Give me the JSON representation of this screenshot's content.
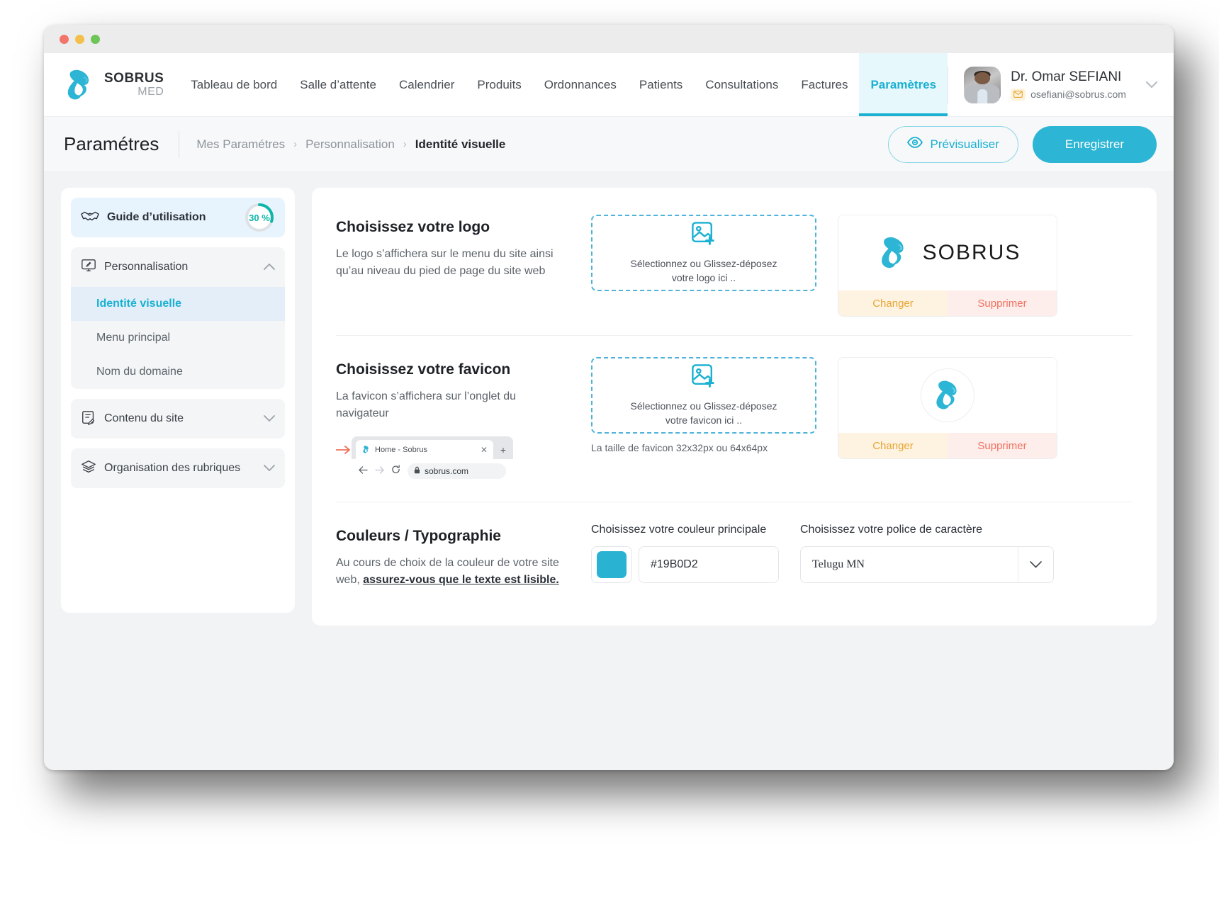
{
  "window": {
    "traffic_lights": [
      "close",
      "minimize",
      "maximize"
    ]
  },
  "navbar": {
    "brand": {
      "name": "SOBRUS",
      "sub": "MED",
      "logo_icon": "sobrus-swan-logo"
    },
    "links": [
      {
        "label": "Tableau de bord",
        "active": false
      },
      {
        "label": "Salle d’attente",
        "active": false
      },
      {
        "label": "Calendrier",
        "active": false
      },
      {
        "label": "Produits",
        "active": false
      },
      {
        "label": "Ordonnances",
        "active": false
      },
      {
        "label": "Patients",
        "active": false
      },
      {
        "label": "Consultations",
        "active": false
      },
      {
        "label": "Factures",
        "active": false
      },
      {
        "label": "Paramètres",
        "active": true
      }
    ],
    "user": {
      "name": "Dr. Omar SEFIANI",
      "email": "osefiani@sobrus.com",
      "mail_icon": "envelope-icon",
      "caret_icon": "chevron-down-icon"
    }
  },
  "page_header": {
    "title": "Paramétres",
    "breadcrumb": [
      {
        "label": "Mes Paramétres",
        "current": false
      },
      {
        "label": "Personnalisation",
        "current": false
      },
      {
        "label": "Identité visuelle",
        "current": true
      }
    ],
    "separator": "›",
    "preview_button": {
      "label": "Prévisualiser",
      "icon": "eye-icon"
    },
    "save_button": {
      "label": "Enregistrer"
    }
  },
  "sidebar": {
    "guide": {
      "label": "Guide d’utilisation",
      "icon": "handshake-icon",
      "percent_label": "30 %",
      "percent_value": 30,
      "ring_color": "#0fb6a8"
    },
    "groups": [
      {
        "label": "Personnalisation",
        "icon": "monitor-brush-icon",
        "caret": "chevron-up-icon",
        "expanded": true,
        "items": [
          {
            "label": "Identité visuelle",
            "active": true
          },
          {
            "label": "Menu principal",
            "active": false
          },
          {
            "label": "Nom du domaine",
            "active": false
          }
        ]
      },
      {
        "label": "Contenu du site",
        "icon": "document-edit-icon",
        "caret": "chevron-down-icon",
        "expanded": false,
        "items": []
      },
      {
        "label": "Organisation des rubriques",
        "icon": "layers-icon",
        "caret": "chevron-down-icon",
        "expanded": false,
        "items": []
      }
    ]
  },
  "main": {
    "logo_section": {
      "title": "Choisissez votre logo",
      "description": "Le logo s’affichera sur le menu du site ainsi qu’au niveau du pied de page du site web",
      "dropzone": {
        "icon": "image-add-icon",
        "line1": "Sélectionnez ou Glissez-déposez",
        "line2": "votre logo ici .."
      },
      "preview": {
        "type": "logo-wordmark",
        "wordmark": "SOBRUS",
        "change_label": "Changer",
        "delete_label": "Supprimer"
      }
    },
    "favicon_section": {
      "title": "Choisissez votre favicon",
      "description": "La favicon s’affichera sur l’onglet du navigateur",
      "browser_mock": {
        "tab_title": "Home - Sobrus",
        "tab_favicon": "sobrus-swan-icon",
        "close_icon": "close-icon",
        "new_tab_icon": "plus-icon",
        "back_icon": "arrow-left-icon",
        "forward_icon": "arrow-right-icon",
        "reload_icon": "reload-icon",
        "lock_icon": "lock-icon",
        "url": "sobrus.com",
        "pointer_icon": "arrow-pointer-icon"
      },
      "dropzone": {
        "icon": "image-add-icon",
        "line1": "Sélectionnez ou Glissez-déposez",
        "line2": "votre favicon ici .."
      },
      "size_note": "La taille de favicon 32x32px ou 64x64px",
      "preview": {
        "type": "favicon-circle",
        "change_label": "Changer",
        "delete_label": "Supprimer"
      }
    },
    "colors_section": {
      "title": "Couleurs / Typographie",
      "description_pre": "Au cours de choix de la couleur de votre site web, ",
      "description_emph": "assurez-vous que le texte est lisible.",
      "color_field": {
        "label": "Choisissez votre couleur principale",
        "value": "#19B0D2",
        "swatch": "#29b2d2"
      },
      "font_field": {
        "label": "Choisissez votre police de caractère",
        "value": "Telugu MN",
        "caret": "chevron-down-icon"
      }
    }
  },
  "theme": {
    "accent": "#19B0D2",
    "accent_dark": "#2cb5d4",
    "accent_soft": "#e7f8fc",
    "page_bg": "#f2f3f5",
    "warn": "#e8a534",
    "danger": "#f1705e",
    "teal": "#0fb6a8"
  }
}
